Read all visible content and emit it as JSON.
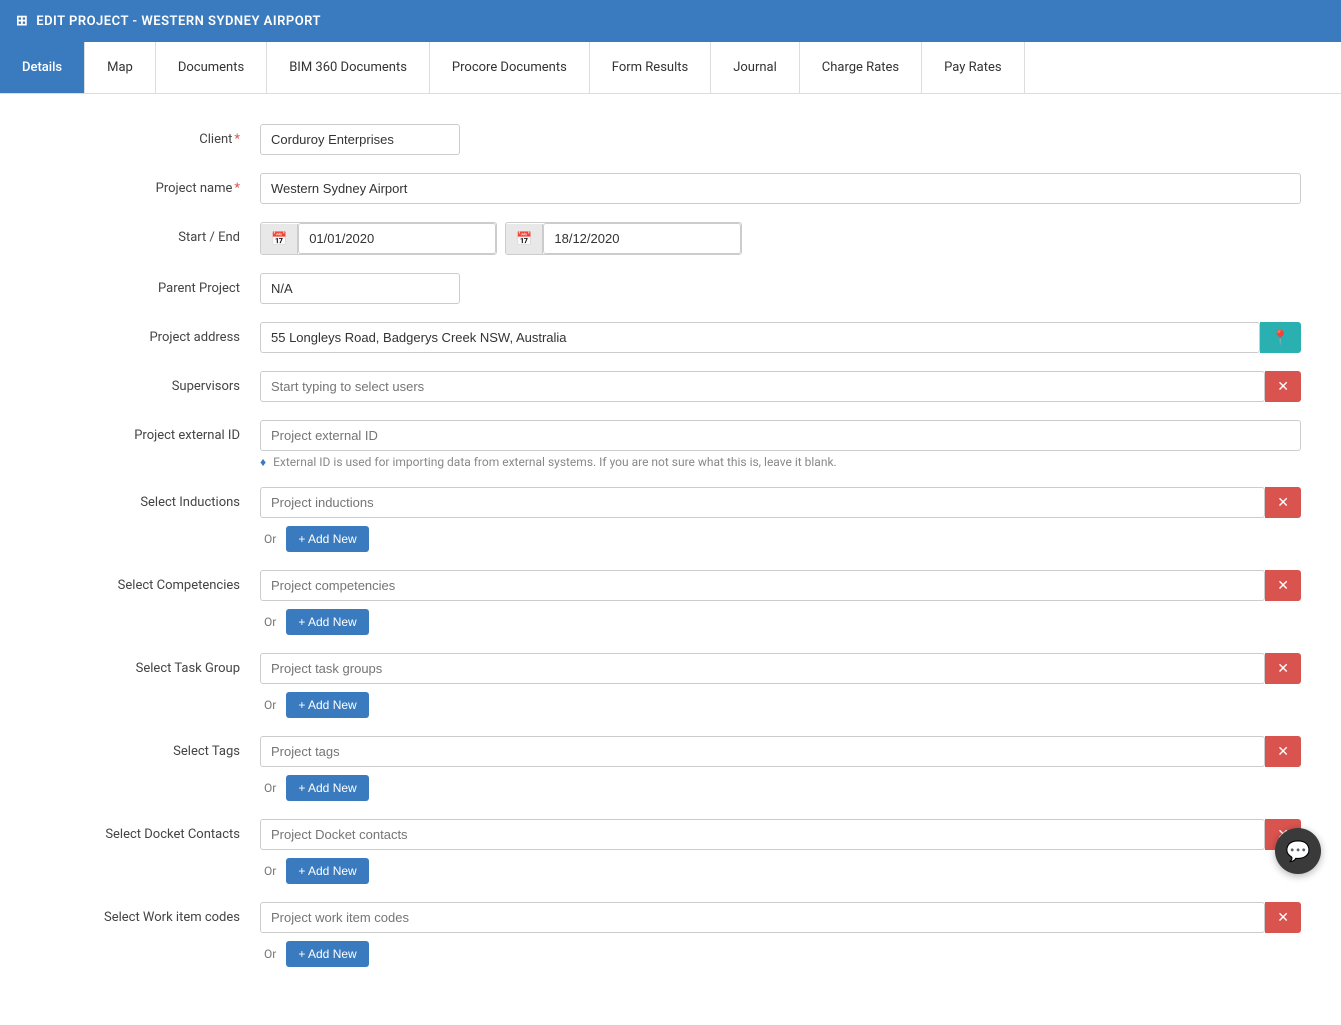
{
  "header": {
    "icon": "⊞",
    "title": "EDIT PROJECT - WESTERN SYDNEY AIRPORT"
  },
  "tabs": [
    {
      "label": "Details",
      "active": true
    },
    {
      "label": "Map",
      "active": false
    },
    {
      "label": "Documents",
      "active": false
    },
    {
      "label": "BIM 360 Documents",
      "active": false
    },
    {
      "label": "Procore Documents",
      "active": false
    },
    {
      "label": "Form Results",
      "active": false
    },
    {
      "label": "Journal",
      "active": false
    },
    {
      "label": "Charge Rates",
      "active": false
    },
    {
      "label": "Pay Rates",
      "active": false
    }
  ],
  "form": {
    "client_label": "Client",
    "client_value": "Corduroy Enterprises",
    "project_name_label": "Project name",
    "project_name_value": "Western Sydney Airport",
    "start_end_label": "Start / End",
    "start_date": "01/01/2020",
    "end_date": "18/12/2020",
    "parent_project_label": "Parent Project",
    "parent_project_value": "N/A",
    "project_address_label": "Project address",
    "project_address_value": "55 Longleys Road, Badgerys Creek NSW, Australia",
    "supervisors_label": "Supervisors",
    "supervisors_placeholder": "Start typing to select users",
    "project_external_id_label": "Project external ID",
    "project_external_id_placeholder": "Project external ID",
    "external_id_help": "External ID is used for importing data from external systems. If you are not sure what this is, leave it blank.",
    "select_inductions_label": "Select Inductions",
    "select_inductions_placeholder": "Project inductions",
    "select_competencies_label": "Select Competencies",
    "select_competencies_placeholder": "Project competencies",
    "select_task_group_label": "Select Task Group",
    "select_task_group_placeholder": "Project task groups",
    "select_tags_label": "Select Tags",
    "select_tags_placeholder": "Project tags",
    "select_docket_contacts_label": "Select Docket Contacts",
    "select_docket_contacts_placeholder": "Project Docket contacts",
    "select_work_item_codes_label": "Select Work item codes",
    "select_work_item_codes_placeholder": "Project work item codes",
    "add_new_label": "+ Add New",
    "or_label": "Or"
  },
  "colors": {
    "header_bg": "#3a7bbf",
    "active_tab": "#3a7bbf",
    "map_btn": "#2ab0b0",
    "x_btn": "#d9534f",
    "add_btn": "#3a7bbf"
  }
}
